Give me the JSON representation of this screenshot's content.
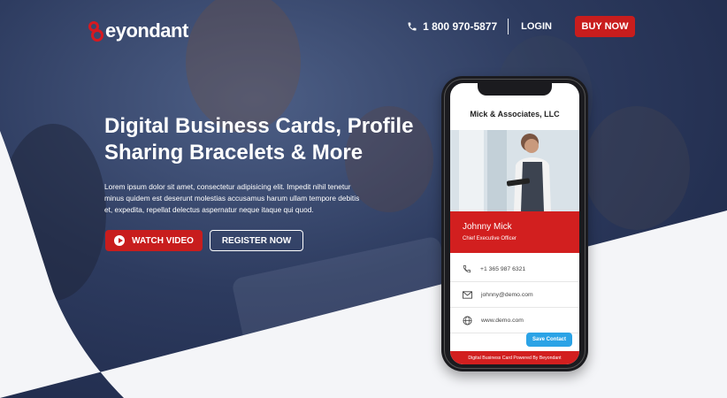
{
  "brand": {
    "logo_text": "eyondant",
    "accent_color": "#c81d1d",
    "hero_color": "#2d3b5f"
  },
  "nav": {
    "phone_icon": "phone-icon",
    "phone_number": "1 800 970-5877",
    "login_label": "LOGIN",
    "buy_label": "BUY NOW"
  },
  "hero": {
    "headline_line1": "Digital Business Cards, Profile",
    "headline_line2": "Sharing Bracelets & More",
    "description": "Lorem ipsum dolor sit amet, consectetur adipisicing elit. Impedit nihil tenetur minus quidem est deserunt molestias accusamus harum ullam tempore debitis et, expedita, repellat delectus aspernatur neque itaque qui quod.",
    "watch_label": "WATCH VIDEO",
    "register_label": "REGISTER NOW"
  },
  "card": {
    "company": "Mick & Associates, LLC",
    "name": "Johnny Mick",
    "role": "Chief Executive Officer",
    "phone": "+1 365 987 6321",
    "email": "johnny@demo.com",
    "website": "www.demo.com",
    "save_label": "Save Contact",
    "footer": "Digital Business Card Powered By Beyondant",
    "save_color": "#2ba3e6"
  }
}
